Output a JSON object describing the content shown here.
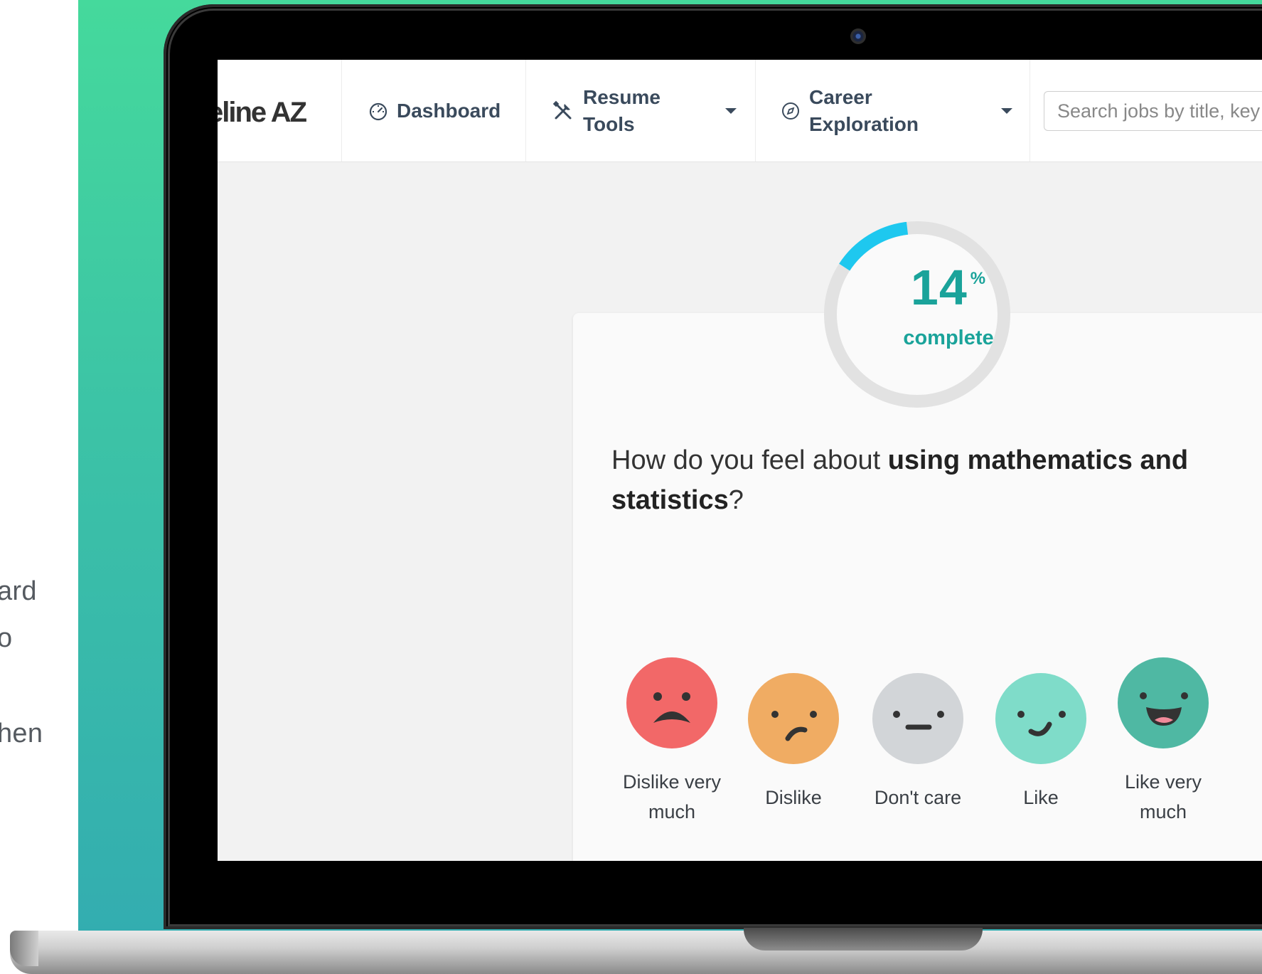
{
  "side_fragments": [
    "ard",
    "o",
    "hen"
  ],
  "app": {
    "logo_fragment": "eline AZ",
    "nav": {
      "dashboard_label": "Dashboard",
      "resume_tools_line1": "Resume",
      "resume_tools_line2": "Tools",
      "career_line1": "Career",
      "career_line2": "Exploration"
    },
    "search": {
      "placeholder": "Search jobs by title, key"
    }
  },
  "progress": {
    "percent": 14,
    "percent_text": "14",
    "percent_sign": "%",
    "label": "complete",
    "accent_color": "#1ec8ef",
    "track_color": "#e2e2e2",
    "text_color": "#1aa39a"
  },
  "question": {
    "prefix": "How do you feel about ",
    "emphasis": "using mathematics and statistics",
    "suffix": "?"
  },
  "options": [
    {
      "line1": "Dislike very",
      "line2": "much",
      "color": "#f26868"
    },
    {
      "line1": "Dislike",
      "line2": "",
      "color": "#f0ac63"
    },
    {
      "line1": "Don't care",
      "line2": "",
      "color": "#d2d5d8"
    },
    {
      "line1": "Like",
      "line2": "",
      "color": "#7fdcc9"
    },
    {
      "line1": "Like very",
      "line2": "much",
      "color": "#4fb8a3"
    }
  ],
  "colors": {
    "gradient_top": "#45d99c",
    "gradient_bottom": "#33adb0"
  }
}
